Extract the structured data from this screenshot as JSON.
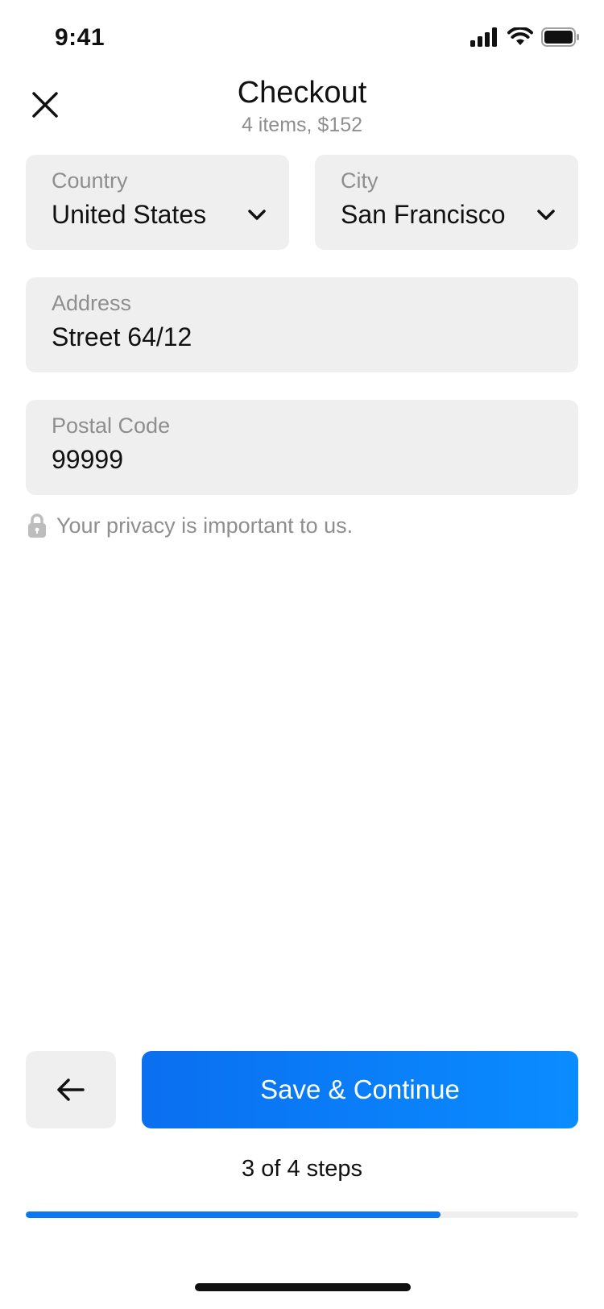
{
  "status_bar": {
    "time": "9:41"
  },
  "header": {
    "title": "Checkout",
    "subtitle": "4 items, $152",
    "close_icon": "close-icon"
  },
  "form": {
    "country": {
      "label": "Country",
      "value": "United States"
    },
    "city": {
      "label": "City",
      "value": "San Francisco"
    },
    "address": {
      "label": "Address",
      "value": "Street 64/12"
    },
    "postal_code": {
      "label": "Postal Code",
      "value": "99999"
    },
    "privacy_note": "Your privacy is important to us."
  },
  "footer": {
    "back_icon": "arrow-left-icon",
    "primary_label": "Save & Continue",
    "steps_text": "3 of 4 steps",
    "progress_fraction": 0.75
  },
  "colors": {
    "accent": "#0a78f5",
    "field_bg": "#efefef",
    "muted_text": "#8e8e8e"
  }
}
